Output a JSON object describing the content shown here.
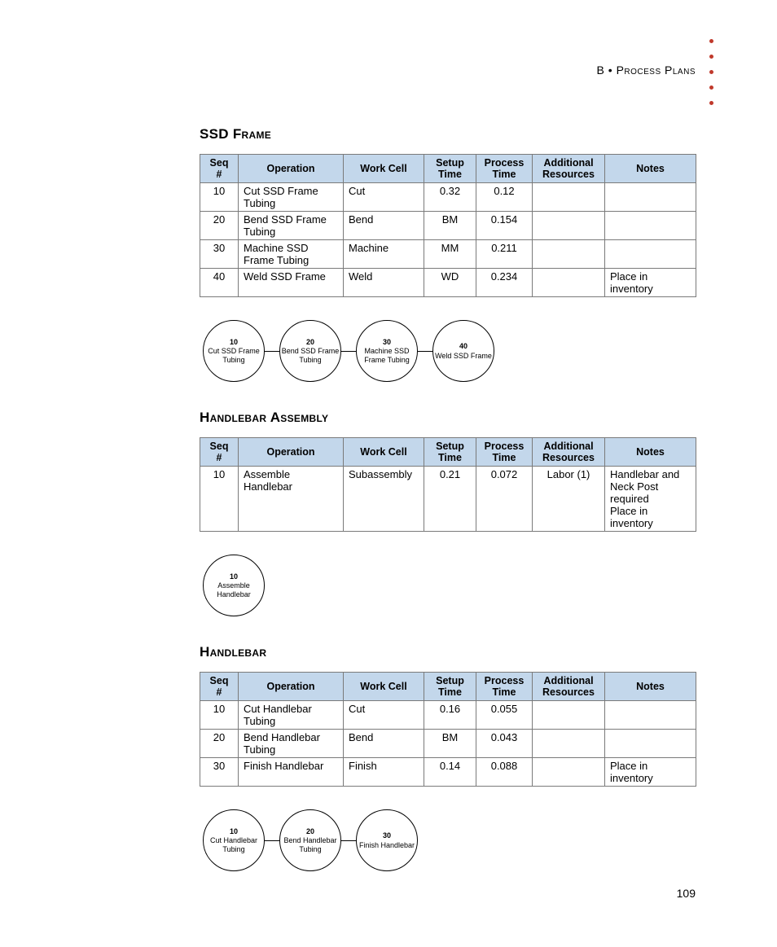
{
  "header": {
    "section_letter": "B",
    "bullet": "•",
    "section_name": "Process Plans"
  },
  "page_number": "109",
  "table_headers": [
    "Seq #",
    "Operation",
    "Work Cell",
    "Setup Time",
    "Process Time",
    "Additional Resources",
    "Notes"
  ],
  "sections": [
    {
      "title": "SSD Frame",
      "rows": [
        {
          "seq": "10",
          "op": "Cut SSD Frame Tubing",
          "wc": "Cut",
          "setup": "0.32",
          "proc": "0.12",
          "res": "",
          "notes": ""
        },
        {
          "seq": "20",
          "op": "Bend SSD Frame Tubing",
          "wc": "Bend",
          "setup": "BM",
          "proc": "0.154",
          "res": "",
          "notes": ""
        },
        {
          "seq": "30",
          "op": "Machine SSD Frame Tubing",
          "wc": "Machine",
          "setup": "MM",
          "proc": "0.211",
          "res": "",
          "notes": ""
        },
        {
          "seq": "40",
          "op": "Weld SSD Frame",
          "wc": "Weld",
          "setup": "WD",
          "proc": "0.234",
          "res": "",
          "notes": "Place in inventory"
        }
      ],
      "flow": [
        {
          "seq": "10",
          "label": "Cut SSD Frame Tubing"
        },
        {
          "seq": "20",
          "label": "Bend SSD Frame Tubing"
        },
        {
          "seq": "30",
          "label": "Machine SSD Frame Tubing"
        },
        {
          "seq": "40",
          "label": "Weld SSD Frame"
        }
      ]
    },
    {
      "title": "Handlebar Assembly",
      "rows": [
        {
          "seq": "10",
          "op": "Assemble Handlebar",
          "wc": "Subassembly",
          "setup": "0.21",
          "proc": "0.072",
          "res": "Labor (1)",
          "notes": "Handlebar and Neck Post required\nPlace in inventory"
        }
      ],
      "flow": [
        {
          "seq": "10",
          "label": "Assemble Handlebar"
        }
      ]
    },
    {
      "title": "Handlebar",
      "rows": [
        {
          "seq": "10",
          "op": "Cut Handlebar Tubing",
          "wc": "Cut",
          "setup": "0.16",
          "proc": "0.055",
          "res": "",
          "notes": ""
        },
        {
          "seq": "20",
          "op": "Bend Handlebar Tubing",
          "wc": "Bend",
          "setup": "BM",
          "proc": "0.043",
          "res": "",
          "notes": ""
        },
        {
          "seq": "30",
          "op": "Finish Handlebar",
          "wc": "Finish",
          "setup": "0.14",
          "proc": "0.088",
          "res": "",
          "notes": "Place in inventory"
        }
      ],
      "flow": [
        {
          "seq": "10",
          "label": "Cut Handlebar Tubing"
        },
        {
          "seq": "20",
          "label": "Bend Handlebar Tubing"
        },
        {
          "seq": "30",
          "label": "Finish Handlebar"
        }
      ]
    }
  ]
}
